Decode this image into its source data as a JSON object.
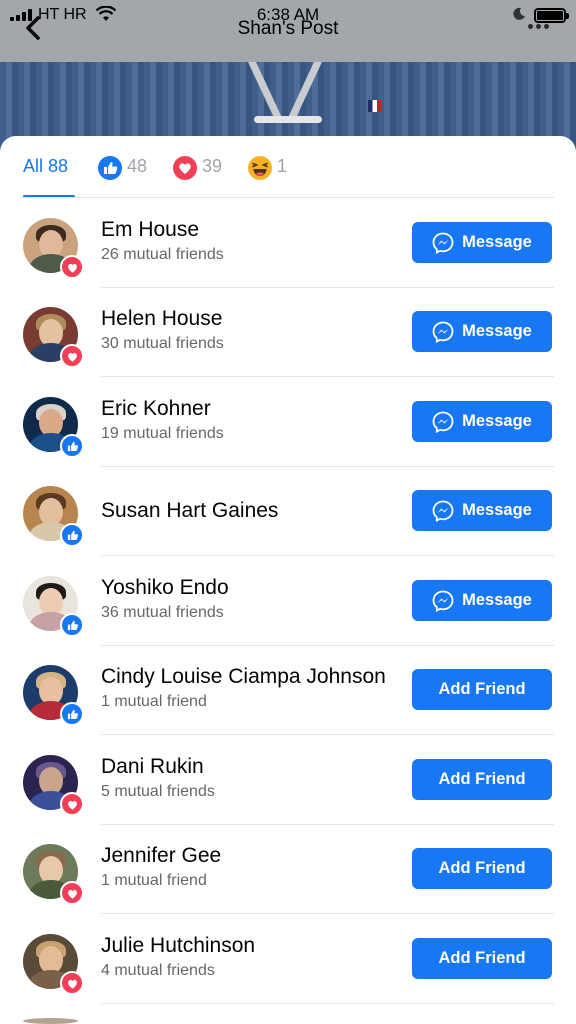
{
  "status": {
    "carrier": "HT HR",
    "time": "6:38 AM"
  },
  "header": {
    "title": "Shan's Post"
  },
  "tabs": [
    {
      "label": "All 88",
      "icon": "none"
    },
    {
      "label": "48",
      "icon": "like-icon"
    },
    {
      "label": "39",
      "icon": "love-icon"
    },
    {
      "label": "1",
      "icon": "haha-icon"
    }
  ],
  "colors": {
    "accent": "#1877f2",
    "love": "#f33e58",
    "like": "#1877f2"
  },
  "people": [
    {
      "name": "Em House",
      "mutual": "26 mutual friends",
      "reaction": "love",
      "action": "Message"
    },
    {
      "name": "Helen House",
      "mutual": "30 mutual friends",
      "reaction": "love",
      "action": "Message"
    },
    {
      "name": "Eric Kohner",
      "mutual": "19 mutual friends",
      "reaction": "like",
      "action": "Message"
    },
    {
      "name": "Susan Hart Gaines",
      "mutual": "",
      "reaction": "like",
      "action": "Message"
    },
    {
      "name": "Yoshiko Endo",
      "mutual": "36 mutual friends",
      "reaction": "like",
      "action": "Message"
    },
    {
      "name": "Cindy Louise Ciampa Johnson",
      "mutual": "1 mutual friend",
      "reaction": "like",
      "action": "Add Friend"
    },
    {
      "name": "Dani Rukin",
      "mutual": "5 mutual friends",
      "reaction": "love",
      "action": "Add Friend"
    },
    {
      "name": "Jennifer Gee",
      "mutual": "1 mutual friend",
      "reaction": "love",
      "action": "Add Friend"
    },
    {
      "name": "Julie Hutchinson",
      "mutual": "4 mutual friends",
      "reaction": "love",
      "action": "Add Friend"
    }
  ]
}
